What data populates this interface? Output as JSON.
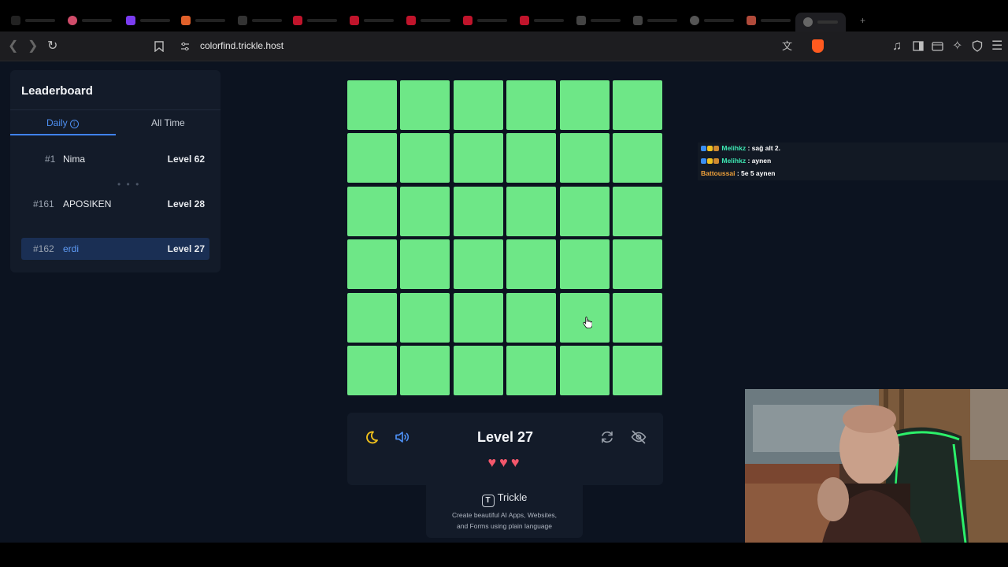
{
  "browser": {
    "url": "colorfind.trickle.host",
    "colors": {
      "tabstrip": "#000000",
      "toolbar": "#1d1d20",
      "brave": "#ff5a1f"
    }
  },
  "leaderboard": {
    "title": "Leaderboard",
    "tabs": [
      {
        "label": "Daily",
        "active": true
      },
      {
        "label": "All Time",
        "active": false
      }
    ],
    "rows": [
      {
        "rank": "#1",
        "name": "Nima",
        "level": "Level 62",
        "current_user": false
      },
      {
        "rank": "#161",
        "name": "APOSIKEN",
        "level": "Level 28",
        "current_user": false
      },
      {
        "rank": "#162",
        "name": "erdi",
        "level": "Level 27",
        "current_user": true
      }
    ],
    "ellipsis": "• • •"
  },
  "game": {
    "grid": {
      "rows": 6,
      "cols": 6,
      "tile_color": "#6ee787"
    },
    "level": "Level 27",
    "hearts": "♥♥♥",
    "lives": 3,
    "controls": [
      "moon-icon",
      "speaker-icon",
      "restart-icon",
      "eye-off-icon"
    ]
  },
  "trickle": {
    "brand": "Trickle",
    "brand_icon": "T",
    "tagline_1": "Create beautiful AI Apps, Websites,",
    "tagline_2": "and Forms using plain language"
  },
  "chat": {
    "lines": [
      {
        "user": "Melihkz",
        "text": " : sağ alt 2.",
        "user_color": "#3ee8b3"
      },
      {
        "user": "Melihkz",
        "text": " : aynen",
        "user_color": "#3ee8b3"
      },
      {
        "user": "Battoussai",
        "text": " : 5e 5 aynen",
        "user_color": "#f0a13a"
      }
    ]
  }
}
